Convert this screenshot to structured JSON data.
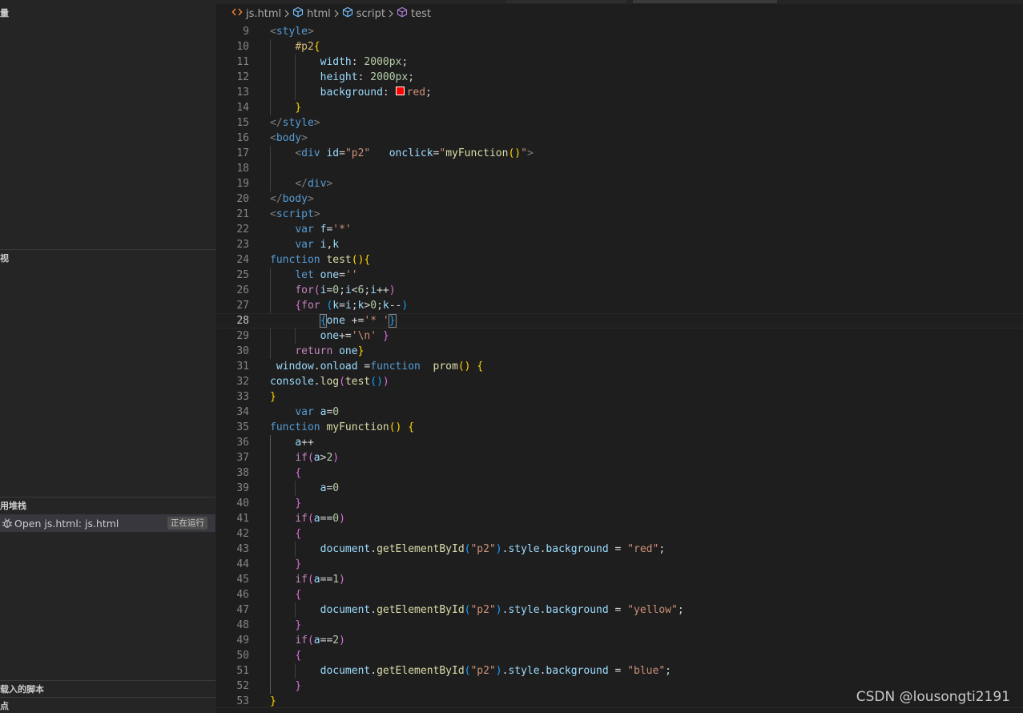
{
  "sidebar": {
    "sections": [
      {
        "key": "variables",
        "title": "量"
      },
      {
        "key": "watch",
        "title": "视"
      },
      {
        "key": "callstack",
        "title": "用堆栈"
      },
      {
        "key": "loaded_scripts",
        "title": "载入的脚本"
      },
      {
        "key": "breakpoints",
        "title": "点"
      }
    ],
    "callstack_item": {
      "label": "Open js.html: js.html",
      "status": "正在运行"
    }
  },
  "breadcrumb": {
    "file": "js.html",
    "items": [
      "html",
      "script",
      "test"
    ]
  },
  "editor": {
    "active_line": 28,
    "lines": [
      {
        "n": 9,
        "tokens": [
          [
            "tg",
            "<"
          ],
          [
            "tn",
            "style"
          ],
          [
            "tg",
            ">"
          ]
        ]
      },
      {
        "n": 10,
        "tokens": [
          [
            "pl",
            "    "
          ],
          [
            "sel",
            "#p2"
          ],
          [
            "b1",
            "{"
          ]
        ]
      },
      {
        "n": 11,
        "tokens": [
          [
            "pl",
            "        "
          ],
          [
            "pp",
            "width"
          ],
          [
            "pl",
            ": "
          ],
          [
            "pv",
            "2000px"
          ],
          [
            "pl",
            ";"
          ]
        ]
      },
      {
        "n": 12,
        "tokens": [
          [
            "pl",
            "        "
          ],
          [
            "pp",
            "height"
          ],
          [
            "pl",
            ": "
          ],
          [
            "pv",
            "2000px"
          ],
          [
            "pl",
            ";"
          ]
        ]
      },
      {
        "n": 13,
        "tokens": [
          [
            "pl",
            "        "
          ],
          [
            "pp",
            "background"
          ],
          [
            "pl",
            ": "
          ],
          [
            "swatch",
            ""
          ],
          [
            "vr",
            "red"
          ],
          [
            "pl",
            ";"
          ]
        ]
      },
      {
        "n": 14,
        "tokens": [
          [
            "pl",
            "    "
          ],
          [
            "b1",
            "}"
          ]
        ]
      },
      {
        "n": 15,
        "tokens": [
          [
            "tg",
            "</"
          ],
          [
            "tn",
            "style"
          ],
          [
            "tg",
            ">"
          ]
        ]
      },
      {
        "n": 16,
        "tokens": [
          [
            "tg",
            "<"
          ],
          [
            "tn",
            "body"
          ],
          [
            "tg",
            ">"
          ]
        ]
      },
      {
        "n": 17,
        "tokens": [
          [
            "pl",
            "    "
          ],
          [
            "tg",
            "<"
          ],
          [
            "tn",
            "div"
          ],
          [
            "pl",
            " "
          ],
          [
            "an",
            "id"
          ],
          [
            "pl",
            "="
          ],
          [
            "av",
            "\"p2\""
          ],
          [
            "pl",
            "   "
          ],
          [
            "an",
            "onclick"
          ],
          [
            "pl",
            "="
          ],
          [
            "av",
            "\""
          ],
          [
            "fn",
            "myFunction"
          ],
          [
            "b1",
            "()"
          ],
          [
            "av",
            "\""
          ],
          [
            "tg",
            ">"
          ]
        ]
      },
      {
        "n": 18,
        "tokens": []
      },
      {
        "n": 19,
        "tokens": [
          [
            "pl",
            "    "
          ],
          [
            "tg",
            "</"
          ],
          [
            "tn",
            "div"
          ],
          [
            "tg",
            ">"
          ]
        ]
      },
      {
        "n": 20,
        "tokens": [
          [
            "tg",
            "</"
          ],
          [
            "tn",
            "body"
          ],
          [
            "tg",
            ">"
          ]
        ]
      },
      {
        "n": 21,
        "tokens": [
          [
            "tg",
            "<"
          ],
          [
            "tn",
            "script"
          ],
          [
            "tg",
            ">"
          ]
        ]
      },
      {
        "n": 22,
        "tokens": [
          [
            "pl",
            "    "
          ],
          [
            "kw",
            "var"
          ],
          [
            "pl",
            " "
          ],
          [
            "id",
            "f"
          ],
          [
            "pl",
            "="
          ],
          [
            "st",
            "'*'"
          ]
        ]
      },
      {
        "n": 23,
        "tokens": [
          [
            "pl",
            "    "
          ],
          [
            "kw",
            "var"
          ],
          [
            "pl",
            " "
          ],
          [
            "id",
            "i"
          ],
          [
            "pl",
            ","
          ],
          [
            "id",
            "k"
          ]
        ]
      },
      {
        "n": 24,
        "tokens": [
          [
            "kw",
            "function"
          ],
          [
            "pl",
            " "
          ],
          [
            "fn",
            "test"
          ],
          [
            "b1",
            "(){"
          ]
        ]
      },
      {
        "n": 25,
        "tokens": [
          [
            "pl",
            "    "
          ],
          [
            "kw",
            "let"
          ],
          [
            "pl",
            " "
          ],
          [
            "id",
            "one"
          ],
          [
            "pl",
            "="
          ],
          [
            "st",
            "''"
          ]
        ]
      },
      {
        "n": 26,
        "tokens": [
          [
            "pl",
            "    "
          ],
          [
            "ck",
            "for"
          ],
          [
            "b2",
            "("
          ],
          [
            "id",
            "i"
          ],
          [
            "pl",
            "="
          ],
          [
            "nu",
            "0"
          ],
          [
            "pl",
            ";"
          ],
          [
            "id",
            "i"
          ],
          [
            "pl",
            "<"
          ],
          [
            "nu",
            "6"
          ],
          [
            "pl",
            ";"
          ],
          [
            "id",
            "i"
          ],
          [
            "pl",
            "++"
          ],
          [
            "b2",
            ")"
          ]
        ]
      },
      {
        "n": 27,
        "tokens": [
          [
            "pl",
            "    "
          ],
          [
            "b2",
            "{"
          ],
          [
            "ck",
            "for"
          ],
          [
            "pl",
            " "
          ],
          [
            "b3",
            "("
          ],
          [
            "id",
            "k"
          ],
          [
            "pl",
            "="
          ],
          [
            "id",
            "i"
          ],
          [
            "pl",
            ";"
          ],
          [
            "id",
            "k"
          ],
          [
            "pl",
            ">"
          ],
          [
            "nu",
            "0"
          ],
          [
            "pl",
            ";"
          ],
          [
            "id",
            "k"
          ],
          [
            "pl",
            "--"
          ],
          [
            "b3",
            ")"
          ]
        ]
      },
      {
        "n": 28,
        "tokens": [
          [
            "pl",
            "        "
          ],
          [
            "brk3",
            "{"
          ],
          [
            "id",
            "one"
          ],
          [
            "pl",
            " +="
          ],
          [
            "st",
            "'* '"
          ],
          [
            "brk3",
            "}"
          ]
        ]
      },
      {
        "n": 29,
        "tokens": [
          [
            "pl",
            "        "
          ],
          [
            "id",
            "one"
          ],
          [
            "pl",
            "+="
          ],
          [
            "st",
            "'\\n'"
          ],
          [
            "pl",
            " "
          ],
          [
            "b2",
            "}"
          ]
        ]
      },
      {
        "n": 30,
        "tokens": [
          [
            "pl",
            "    "
          ],
          [
            "ck",
            "return"
          ],
          [
            "pl",
            " "
          ],
          [
            "id",
            "one"
          ],
          [
            "b1",
            "}"
          ]
        ]
      },
      {
        "n": 31,
        "tokens": [
          [
            "pl",
            " "
          ],
          [
            "id",
            "window"
          ],
          [
            "pl",
            "."
          ],
          [
            "id",
            "onload"
          ],
          [
            "pl",
            " ="
          ],
          [
            "kw",
            "function"
          ],
          [
            "pl",
            "  "
          ],
          [
            "fn",
            "prom"
          ],
          [
            "b1",
            "()"
          ],
          [
            "pl",
            " "
          ],
          [
            "b1",
            "{"
          ]
        ]
      },
      {
        "n": 32,
        "tokens": [
          [
            "id",
            "console"
          ],
          [
            "pl",
            "."
          ],
          [
            "fn",
            "log"
          ],
          [
            "b2",
            "("
          ],
          [
            "fn",
            "test"
          ],
          [
            "b3",
            "()"
          ],
          [
            "b2",
            ")"
          ]
        ]
      },
      {
        "n": 33,
        "tokens": [
          [
            "b1",
            "}"
          ]
        ]
      },
      {
        "n": 34,
        "tokens": [
          [
            "pl",
            "    "
          ],
          [
            "kw",
            "var"
          ],
          [
            "pl",
            " "
          ],
          [
            "id",
            "a"
          ],
          [
            "pl",
            "="
          ],
          [
            "nu",
            "0"
          ]
        ]
      },
      {
        "n": 35,
        "tokens": [
          [
            "kw",
            "function"
          ],
          [
            "pl",
            " "
          ],
          [
            "fn",
            "myFunction"
          ],
          [
            "b1",
            "()"
          ],
          [
            "pl",
            " "
          ],
          [
            "b1",
            "{"
          ]
        ]
      },
      {
        "n": 36,
        "tokens": [
          [
            "pl",
            "    "
          ],
          [
            "id",
            "a"
          ],
          [
            "pl",
            "++"
          ]
        ]
      },
      {
        "n": 37,
        "tokens": [
          [
            "pl",
            "    "
          ],
          [
            "ck",
            "if"
          ],
          [
            "b2",
            "("
          ],
          [
            "id",
            "a"
          ],
          [
            "pl",
            ">"
          ],
          [
            "nu",
            "2"
          ],
          [
            "b2",
            ")"
          ]
        ]
      },
      {
        "n": 38,
        "tokens": [
          [
            "pl",
            "    "
          ],
          [
            "b2",
            "{"
          ]
        ]
      },
      {
        "n": 39,
        "tokens": [
          [
            "pl",
            "        "
          ],
          [
            "id",
            "a"
          ],
          [
            "pl",
            "="
          ],
          [
            "nu",
            "0"
          ]
        ]
      },
      {
        "n": 40,
        "tokens": [
          [
            "pl",
            "    "
          ],
          [
            "b2",
            "}"
          ]
        ]
      },
      {
        "n": 41,
        "tokens": [
          [
            "pl",
            "    "
          ],
          [
            "ck",
            "if"
          ],
          [
            "b2",
            "("
          ],
          [
            "id",
            "a"
          ],
          [
            "pl",
            "=="
          ],
          [
            "nu",
            "0"
          ],
          [
            "b2",
            ")"
          ]
        ]
      },
      {
        "n": 42,
        "tokens": [
          [
            "pl",
            "    "
          ],
          [
            "b2",
            "{"
          ]
        ]
      },
      {
        "n": 43,
        "tokens": [
          [
            "pl",
            "        "
          ],
          [
            "id",
            "document"
          ],
          [
            "pl",
            "."
          ],
          [
            "fn",
            "getElementById"
          ],
          [
            "b3",
            "("
          ],
          [
            "st",
            "\"p2\""
          ],
          [
            "b3",
            ")"
          ],
          [
            "pl",
            "."
          ],
          [
            "id",
            "style"
          ],
          [
            "pl",
            "."
          ],
          [
            "id",
            "background"
          ],
          [
            "pl",
            " = "
          ],
          [
            "st",
            "\"red\""
          ],
          [
            "pl",
            ";"
          ]
        ]
      },
      {
        "n": 44,
        "tokens": [
          [
            "pl",
            "    "
          ],
          [
            "b2",
            "}"
          ]
        ]
      },
      {
        "n": 45,
        "tokens": [
          [
            "pl",
            "    "
          ],
          [
            "ck",
            "if"
          ],
          [
            "b2",
            "("
          ],
          [
            "id",
            "a"
          ],
          [
            "pl",
            "=="
          ],
          [
            "nu",
            "1"
          ],
          [
            "b2",
            ")"
          ]
        ]
      },
      {
        "n": 46,
        "tokens": [
          [
            "pl",
            "    "
          ],
          [
            "b2",
            "{"
          ]
        ]
      },
      {
        "n": 47,
        "tokens": [
          [
            "pl",
            "        "
          ],
          [
            "id",
            "document"
          ],
          [
            "pl",
            "."
          ],
          [
            "fn",
            "getElementById"
          ],
          [
            "b3",
            "("
          ],
          [
            "st",
            "\"p2\""
          ],
          [
            "b3",
            ")"
          ],
          [
            "pl",
            "."
          ],
          [
            "id",
            "style"
          ],
          [
            "pl",
            "."
          ],
          [
            "id",
            "background"
          ],
          [
            "pl",
            " = "
          ],
          [
            "st",
            "\"yellow\""
          ],
          [
            "pl",
            ";"
          ]
        ]
      },
      {
        "n": 48,
        "tokens": [
          [
            "pl",
            "    "
          ],
          [
            "b2",
            "}"
          ]
        ]
      },
      {
        "n": 49,
        "tokens": [
          [
            "pl",
            "    "
          ],
          [
            "ck",
            "if"
          ],
          [
            "b2",
            "("
          ],
          [
            "id",
            "a"
          ],
          [
            "pl",
            "=="
          ],
          [
            "nu",
            "2"
          ],
          [
            "b2",
            ")"
          ]
        ]
      },
      {
        "n": 50,
        "tokens": [
          [
            "pl",
            "    "
          ],
          [
            "b2",
            "{"
          ]
        ]
      },
      {
        "n": 51,
        "tokens": [
          [
            "pl",
            "        "
          ],
          [
            "id",
            "document"
          ],
          [
            "pl",
            "."
          ],
          [
            "fn",
            "getElementById"
          ],
          [
            "b3",
            "("
          ],
          [
            "st",
            "\"p2\""
          ],
          [
            "b3",
            ")"
          ],
          [
            "pl",
            "."
          ],
          [
            "id",
            "style"
          ],
          [
            "pl",
            "."
          ],
          [
            "id",
            "background"
          ],
          [
            "pl",
            " = "
          ],
          [
            "st",
            "\"blue\""
          ],
          [
            "pl",
            ";"
          ]
        ]
      },
      {
        "n": 52,
        "tokens": [
          [
            "pl",
            "    "
          ],
          [
            "b2",
            "}"
          ]
        ]
      },
      {
        "n": 53,
        "tokens": [
          [
            "b1",
            "}"
          ]
        ]
      }
    ]
  },
  "watermark": "CSDN @lousongti2191",
  "colors": {
    "editor_bg": "#1e1e1e",
    "sidebar_bg": "#252526",
    "keyword": "#569cd6",
    "string": "#ce9178",
    "function": "#dcdcaa",
    "variable": "#9cdcfe"
  }
}
